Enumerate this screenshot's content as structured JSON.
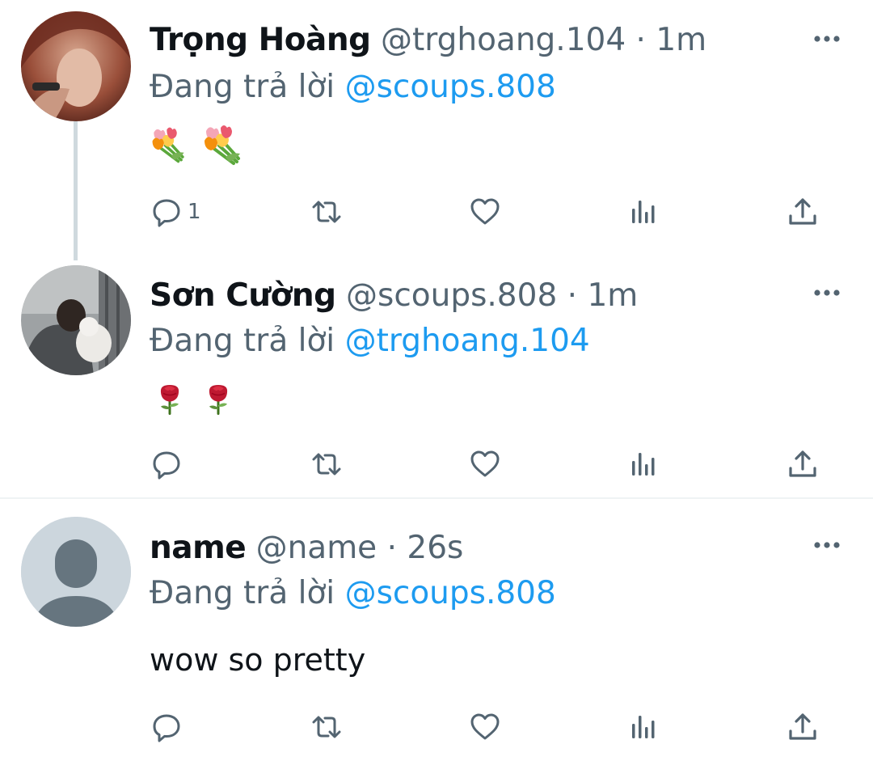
{
  "colors": {
    "link": "#1d9bf0",
    "secondary": "#536471",
    "primary": "#0f1419"
  },
  "tweets": [
    {
      "display_name": "Trọng Hoàng",
      "handle": "@trghoang.104",
      "dot": "·",
      "time": "1m",
      "reply_prefix": "Đang trả lời",
      "reply_to": "@scoups.808",
      "emojis": [
        "tulip-bouquet",
        "tulip-bouquet"
      ],
      "reply_count": "1"
    },
    {
      "display_name": "Sơn Cường",
      "handle": "@scoups.808",
      "dot": "·",
      "time": "1m",
      "reply_prefix": "Đang trả lời",
      "reply_to": "@trghoang.104",
      "emojis": [
        "rose",
        "rose"
      ],
      "reply_count": ""
    },
    {
      "display_name": "name",
      "handle": "@name",
      "dot": "·",
      "time": "26s",
      "reply_prefix": "Đang trả lời",
      "reply_to": "@scoups.808",
      "text": "wow so pretty",
      "reply_count": ""
    }
  ]
}
